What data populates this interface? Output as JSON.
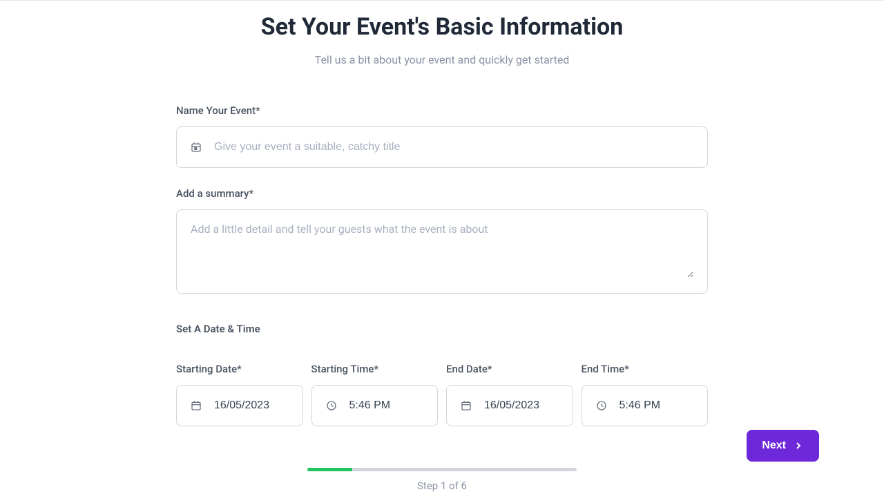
{
  "header": {
    "title": "Set Your Event's Basic Information",
    "subtitle": "Tell us a bit about your event and quickly get started"
  },
  "form": {
    "name_label": "Name Your Event*",
    "name_placeholder": "Give your event a suitable, catchy title",
    "summary_label": "Add a summary*",
    "summary_placeholder": "Add a little detail and tell your guests what the event is about",
    "datetime_section_label": "Set A Date & Time",
    "starting_date_label": "Starting Date*",
    "starting_date_value": "16/05/2023",
    "starting_time_label": "Starting Time*",
    "starting_time_value": "5:46 PM",
    "end_date_label": "End Date*",
    "end_date_value": "16/05/2023",
    "end_time_label": "End Time*",
    "end_time_value": "5:46 PM"
  },
  "progress": {
    "label": "Step 1 of 6"
  },
  "actions": {
    "next_label": "Next"
  }
}
